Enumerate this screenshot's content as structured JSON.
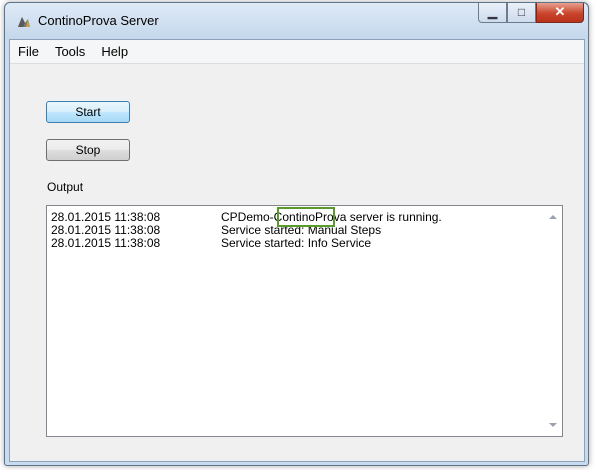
{
  "window": {
    "title": "ContinoProva Server",
    "icons": {
      "app": "app-logo-icon",
      "minimize": "minimize-icon",
      "maximize": "maximize-icon",
      "close": "close-icon"
    }
  },
  "menu": [
    {
      "label": "File"
    },
    {
      "label": "Tools"
    },
    {
      "label": "Help"
    }
  ],
  "buttons": {
    "start": "Start",
    "stop": "Stop"
  },
  "output": {
    "label": "Output",
    "entries": [
      {
        "time": "28.01.2015 11:38:08",
        "message": "CPDemo-ContinoProva server is running."
      },
      {
        "time": "28.01.2015 11:38:08",
        "message": "Service started: Manual Steps"
      },
      {
        "time": "28.01.2015 11:38:08",
        "message": "Service started: Info Service"
      }
    ]
  },
  "colors": {
    "highlight_border": "#5a9a2a",
    "window_frame": "#c9dbee",
    "close_button": "#c9452b"
  }
}
